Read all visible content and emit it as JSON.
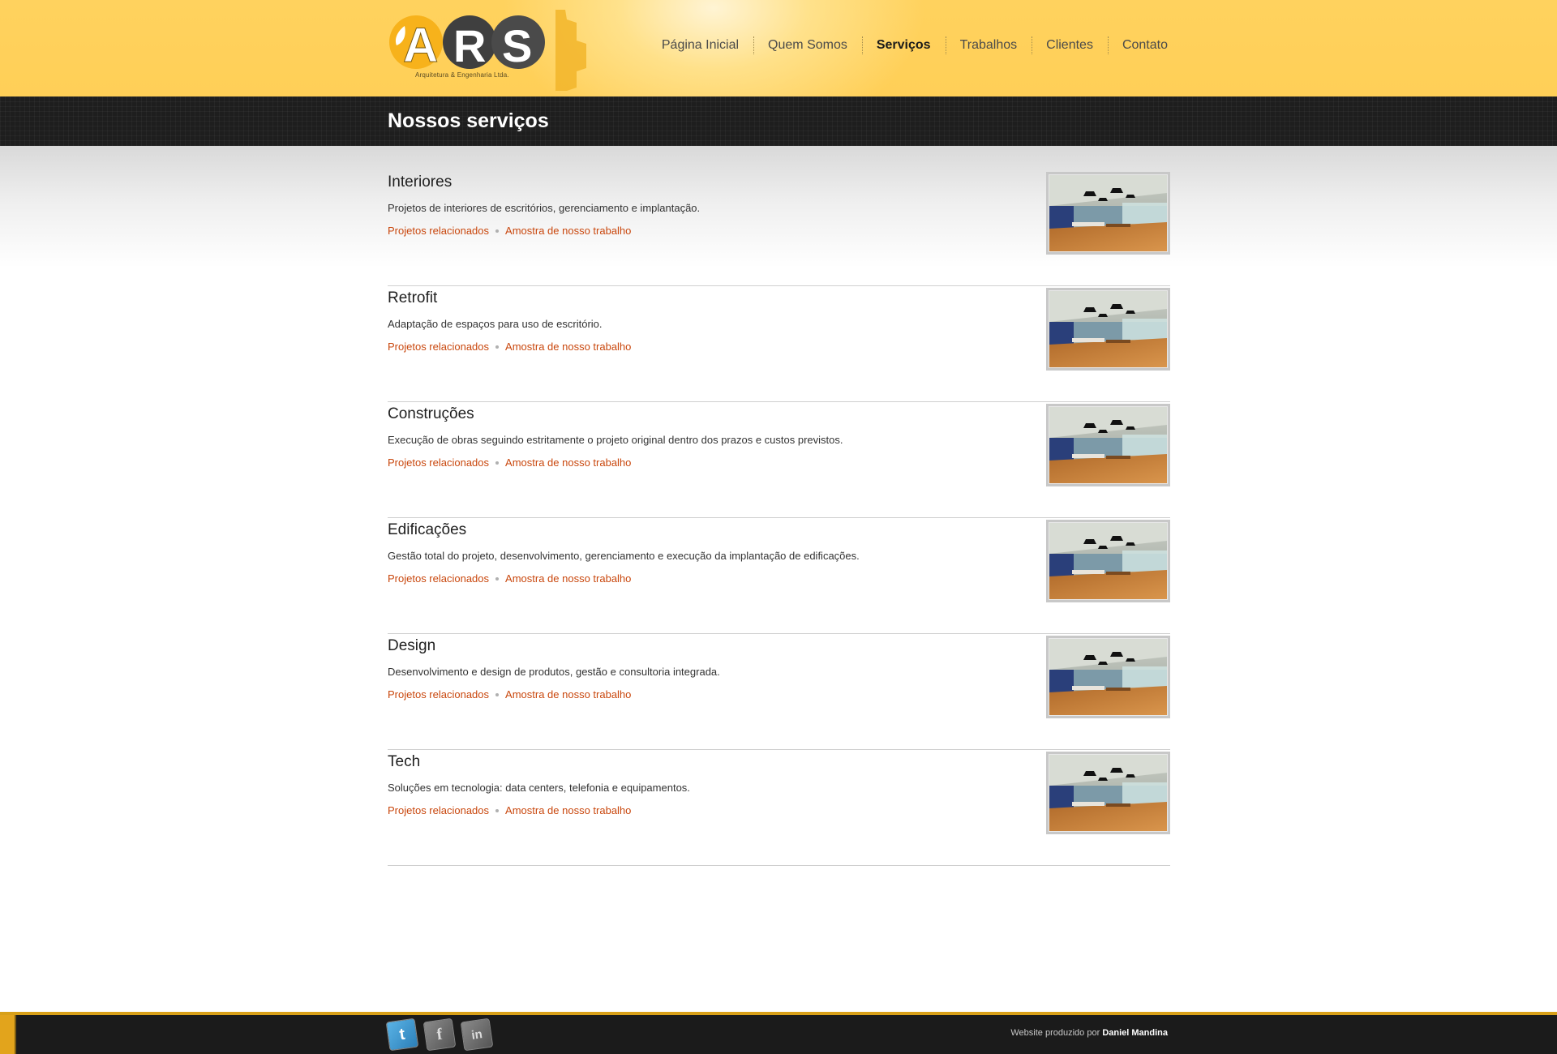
{
  "brand": {
    "logo_text": "ARS",
    "tagline": "Arquitetura & Engenharia Ltda."
  },
  "nav": {
    "items": [
      {
        "label": "Página Inicial",
        "active": false
      },
      {
        "label": "Quem Somos",
        "active": false
      },
      {
        "label": "Serviços",
        "active": true
      },
      {
        "label": "Trabalhos",
        "active": false
      },
      {
        "label": "Clientes",
        "active": false
      },
      {
        "label": "Contato",
        "active": false
      }
    ]
  },
  "page": {
    "title": "Nossos serviços"
  },
  "services": [
    {
      "title": "Interiores",
      "description": "Projetos de interiores de escritórios, gerenciamento e implantação.",
      "link_related": "Projetos relacionados",
      "link_sample": "Amostra de nosso trabalho"
    },
    {
      "title": "Retrofit",
      "description": "Adaptação de espaços para uso de escritório.",
      "link_related": "Projetos relacionados",
      "link_sample": "Amostra de nosso trabalho"
    },
    {
      "title": "Construções",
      "description": "Execução de obras seguindo estritamente o projeto original dentro dos prazos e custos previstos.",
      "link_related": "Projetos relacionados",
      "link_sample": "Amostra de nosso trabalho"
    },
    {
      "title": "Edificações",
      "description": "Gestão total do projeto, desenvolvimento, gerenciamento e execução da implantação de edificações.",
      "link_related": "Projetos relacionados",
      "link_sample": "Amostra de nosso trabalho"
    },
    {
      "title": "Design",
      "description": "Desenvolvimento e design de produtos, gestão e consultoria integrada.",
      "link_related": "Projetos relacionados",
      "link_sample": "Amostra de nosso trabalho"
    },
    {
      "title": "Tech",
      "description": "Soluções em tecnologia: data centers, telefonia e equipamentos.",
      "link_related": "Projetos relacionados",
      "link_sample": "Amostra de nosso trabalho"
    }
  ],
  "footer": {
    "social": [
      {
        "icon": "twitter-icon",
        "glyph": "t"
      },
      {
        "icon": "facebook-icon",
        "glyph": "f"
      },
      {
        "icon": "linkedin-icon",
        "glyph": "in"
      }
    ],
    "credit_prefix": "Website produzido por",
    "credit_name": "Daniel Mandina"
  },
  "colors": {
    "header_yellow": "#ffd25e",
    "link_orange": "#c9470d",
    "dark_bar": "#1e1e1e",
    "footer_accent": "#e2a41c"
  }
}
